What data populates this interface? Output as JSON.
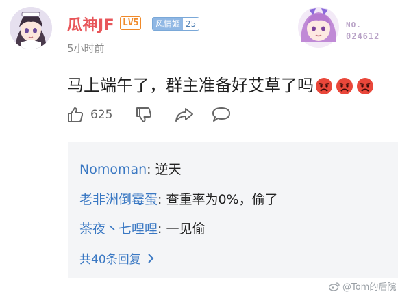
{
  "post": {
    "username": "瓜神JF",
    "level": "LV5",
    "fan_badge": {
      "name": "风情姬",
      "level": "25"
    },
    "timestamp": "5小时前",
    "pendant": {
      "label": "NO.",
      "number": "024612"
    },
    "text": "马上端午了，群主准备好艾草了吗",
    "emoji": [
      "angry-face-icon",
      "angry-face-icon",
      "angry-face-icon"
    ]
  },
  "actions": {
    "like_count": "625",
    "icons": [
      "thumbs-up-icon",
      "thumbs-down-icon",
      "share-icon",
      "comment-icon"
    ]
  },
  "replies": [
    {
      "user": "Nomoman",
      "sep": ": ",
      "text": "逆天"
    },
    {
      "user": "老非洲倒霉蛋",
      "sep": ": ",
      "text": "查重率为0%，偷了"
    },
    {
      "user": "茶夜丶七哩哩",
      "sep": ": ",
      "text": "一见偷"
    }
  ],
  "more_replies": "共40条回复",
  "watermark": "@Tom的后院",
  "colors": {
    "username": "#e8565a",
    "reply_user": "#3a78c3",
    "level": "#f08a2a",
    "reply_bg": "#f4f5f7"
  }
}
